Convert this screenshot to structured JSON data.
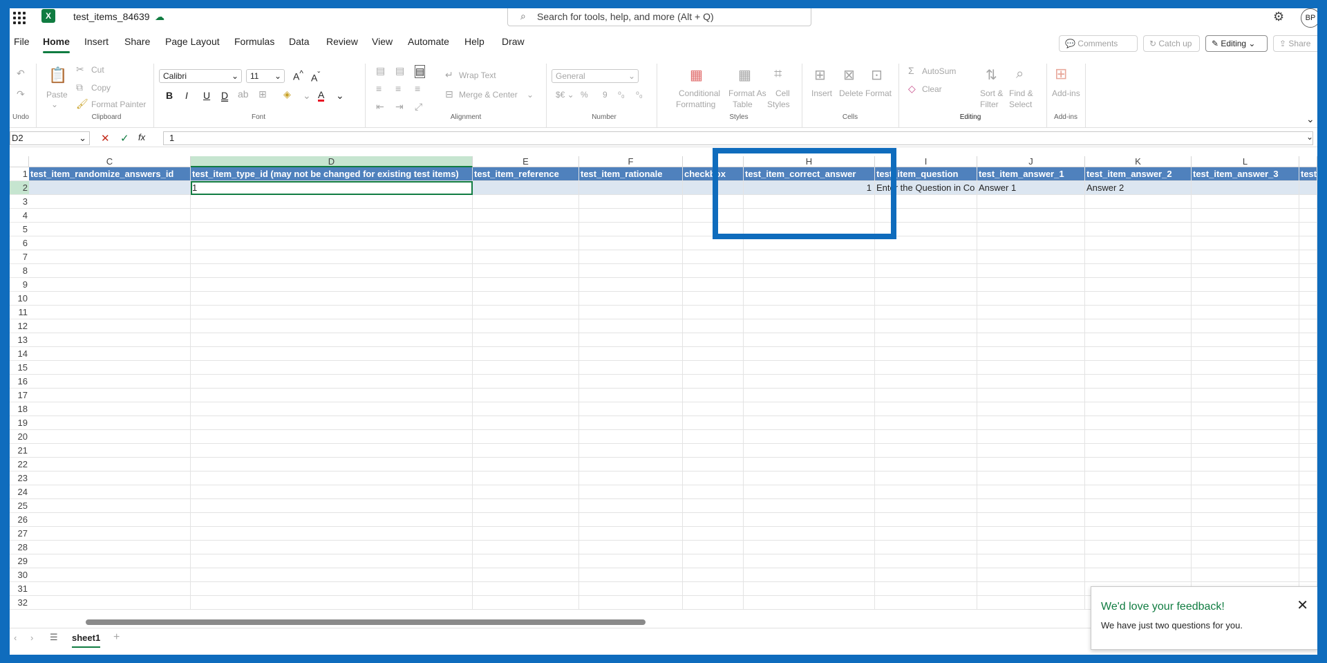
{
  "app": {
    "doc_title": "test_items_84639",
    "search_placeholder": "Search for tools, help, and more (Alt + Q)",
    "avatar_initials": "BP"
  },
  "menu": {
    "tabs": [
      "File",
      "Home",
      "Insert",
      "Share",
      "Page Layout",
      "Formulas",
      "Data",
      "Review",
      "View",
      "Automate",
      "Help",
      "Draw"
    ],
    "active": "Home",
    "comments": "Comments",
    "catch_up": "Catch up",
    "editing": "Editing",
    "share": "Share"
  },
  "ribbon": {
    "undo_label": "Undo",
    "paste": "Paste",
    "cut": "Cut",
    "copy": "Copy",
    "format_painter": "Format Painter",
    "clipboard": "Clipboard",
    "font_name": "Calibri",
    "font_size": "11",
    "font": "Font",
    "wrap_text": "Wrap Text",
    "merge_center": "Merge & Center",
    "alignment": "Alignment",
    "number_format": "General",
    "number": "Number",
    "conditional_1": "Conditional",
    "conditional_2": "Formatting",
    "format_as_1": "Format As",
    "format_as_2": "Table",
    "cell_styles_1": "Cell",
    "cell_styles_2": "Styles",
    "styles": "Styles",
    "insert": "Insert",
    "delete": "Delete",
    "format": "Format",
    "cells": "Cells",
    "autosum": "AutoSum",
    "clear": "Clear",
    "sort_1": "Sort &",
    "sort_2": "Filter",
    "find_1": "Find &",
    "find_2": "Select",
    "editing": "Editing",
    "addins": "Add-ins",
    "addins_group": "Add-ins"
  },
  "formula_bar": {
    "name_box": "D2",
    "fx": "fx",
    "value": "1"
  },
  "grid": {
    "columns": [
      "C",
      "D",
      "E",
      "F",
      "",
      "H",
      "I",
      "J",
      "K",
      "L",
      ""
    ],
    "header_row": [
      "test_item_randomize_answers_id",
      "test_item_type_id (may not be changed for existing test items)",
      "test_item_reference",
      "test_item_rationale",
      "checkbox",
      "test_item_correct_answer",
      "test_item_question",
      "test_item_answer_1",
      "test_item_answer_2",
      "test_item_answer_3",
      "test"
    ],
    "row2": [
      "",
      "1",
      "",
      "",
      "",
      "1",
      "Enter the Question in Co",
      "Answer 1",
      "Answer 2",
      "",
      ""
    ],
    "row_numbers": [
      "1",
      "2",
      "3",
      "4",
      "5",
      "6",
      "7",
      "8",
      "9",
      "10",
      "11",
      "12",
      "13",
      "14",
      "15",
      "16",
      "17",
      "18",
      "19",
      "20",
      "21",
      "22",
      "23",
      "24",
      "25",
      "26",
      "27",
      "28",
      "29",
      "30",
      "31",
      "32"
    ]
  },
  "sheets": {
    "active": "sheet1"
  },
  "toast": {
    "title": "We'd love your feedback!",
    "body": "We have just two questions for you."
  }
}
